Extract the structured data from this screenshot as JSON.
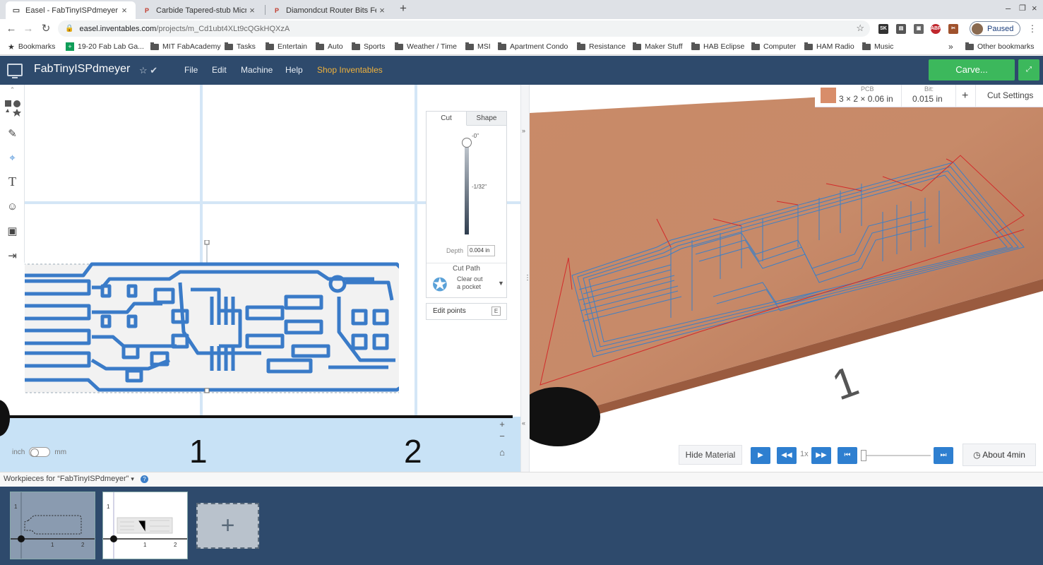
{
  "browser": {
    "tabs": [
      {
        "label": "Easel - FabTinyISPdmeyer",
        "active": true
      },
      {
        "label": "Carbide Tapered-stub Micro-",
        "active": false
      },
      {
        "label": "Diamondcut Router Bits Feed",
        "active": false
      }
    ],
    "new_tab": "+",
    "url_host": "easel.inventables.com",
    "url_path": "/projects/m_Cd1ubt4XLt9cQGkHQXzA",
    "profile_status": "Paused",
    "extensions": [
      "SK",
      "ABP"
    ],
    "bookmarks": [
      {
        "label": "Bookmarks",
        "icon": "star-icon"
      },
      {
        "label": "19-20 Fab Lab Ga...",
        "icon": "sheets-icon"
      },
      {
        "label": "MIT FabAcademy",
        "icon": "folder-icon"
      },
      {
        "label": "Tasks",
        "icon": "folder-icon"
      },
      {
        "label": "Entertain",
        "icon": "folder-icon"
      },
      {
        "label": "Auto",
        "icon": "folder-icon"
      },
      {
        "label": "Sports",
        "icon": "folder-icon"
      },
      {
        "label": "Weather / Time",
        "icon": "folder-icon"
      },
      {
        "label": "MSI",
        "icon": "folder-icon"
      },
      {
        "label": "Apartment Condo",
        "icon": "folder-icon"
      },
      {
        "label": "Resistance",
        "icon": "folder-icon"
      },
      {
        "label": "Maker Stuff",
        "icon": "folder-icon"
      },
      {
        "label": "HAB Eclipse",
        "icon": "folder-icon"
      },
      {
        "label": "Computer",
        "icon": "folder-icon"
      },
      {
        "label": "HAM Radio",
        "icon": "folder-icon"
      },
      {
        "label": "Music",
        "icon": "folder-icon"
      }
    ],
    "bookmarks_overflow": "»",
    "other_bookmarks": "Other bookmarks"
  },
  "app": {
    "project_title": "FabTinyISPdmeyer",
    "menu": [
      "File",
      "Edit",
      "Machine",
      "Help"
    ],
    "shop_menu": "Shop Inventables",
    "carve_button": "Carve...",
    "accent_color": "#3cb85c",
    "header_color": "#2e4a6c"
  },
  "canvas": {
    "ruler_numbers": [
      "1",
      "2"
    ],
    "unit_left": "inch",
    "unit_right": "mm",
    "zoom_in": "+",
    "zoom_out": "−"
  },
  "cut_panel": {
    "tabs": [
      "Cut",
      "Shape"
    ],
    "depth_top": "-0\"",
    "depth_mid": "-1/32\"",
    "depth_label": "Depth",
    "depth_value": "0.004 in",
    "cut_path_label": "Cut Path",
    "cut_path_line1": "Clear out",
    "cut_path_line2": "a pocket",
    "edit_points": "Edit points",
    "edit_points_key": "E"
  },
  "preview": {
    "material_title": "PCB",
    "material_size": "3 × 2 × 0.06 in",
    "bit_title": "Bit:",
    "bit_value": "0.015 in",
    "add": "+",
    "cut_settings": "Cut Settings",
    "hide_material": "Hide Material",
    "speed": "1x",
    "time_estimate": "About 4min",
    "board_number": "1",
    "board_color": "#c98a68",
    "toolpath_color": "#2f7fd0",
    "travel_color": "#d22b2b"
  },
  "workpieces": {
    "label": "Workpieces for “FabTinyISPdmeyer”",
    "help": "?",
    "thumb_labels": [
      "1",
      "1",
      "2"
    ],
    "add": "+"
  }
}
